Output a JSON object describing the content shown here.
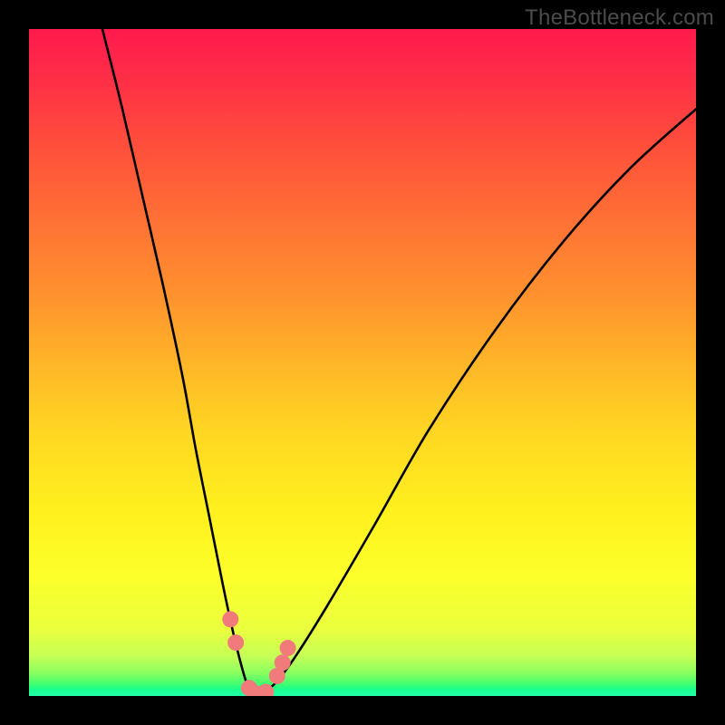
{
  "watermark": "TheBottleneck.com",
  "chart_data": {
    "type": "line",
    "title": "",
    "xlabel": "",
    "ylabel": "",
    "xlim": [
      0,
      100
    ],
    "ylim": [
      0,
      100
    ],
    "series": [
      {
        "name": "bottleneck-curve",
        "x": [
          11,
          14,
          17,
          20,
          23,
          25,
          27,
          29,
          30.5,
          32,
          33,
          34,
          35,
          37,
          40,
          45,
          52,
          60,
          70,
          80,
          90,
          100
        ],
        "values": [
          100,
          88,
          75,
          62,
          48,
          37,
          27,
          17,
          10,
          4,
          1,
          0,
          0.5,
          2,
          6,
          14,
          26,
          40,
          55,
          68,
          79,
          88
        ]
      }
    ],
    "markers": {
      "name": "highlight-points",
      "x": [
        30.2,
        31.0,
        33.0,
        34.0,
        35.5,
        37.2,
        38.0,
        38.8
      ],
      "values": [
        11.5,
        8.0,
        1.2,
        0.4,
        0.6,
        3.0,
        5.0,
        7.2
      ],
      "color": "#f17a7a",
      "size": 9
    },
    "background_gradient": {
      "top": "#ff1a4d",
      "mid": "#fff01e",
      "bottom": "#24ffab"
    }
  }
}
